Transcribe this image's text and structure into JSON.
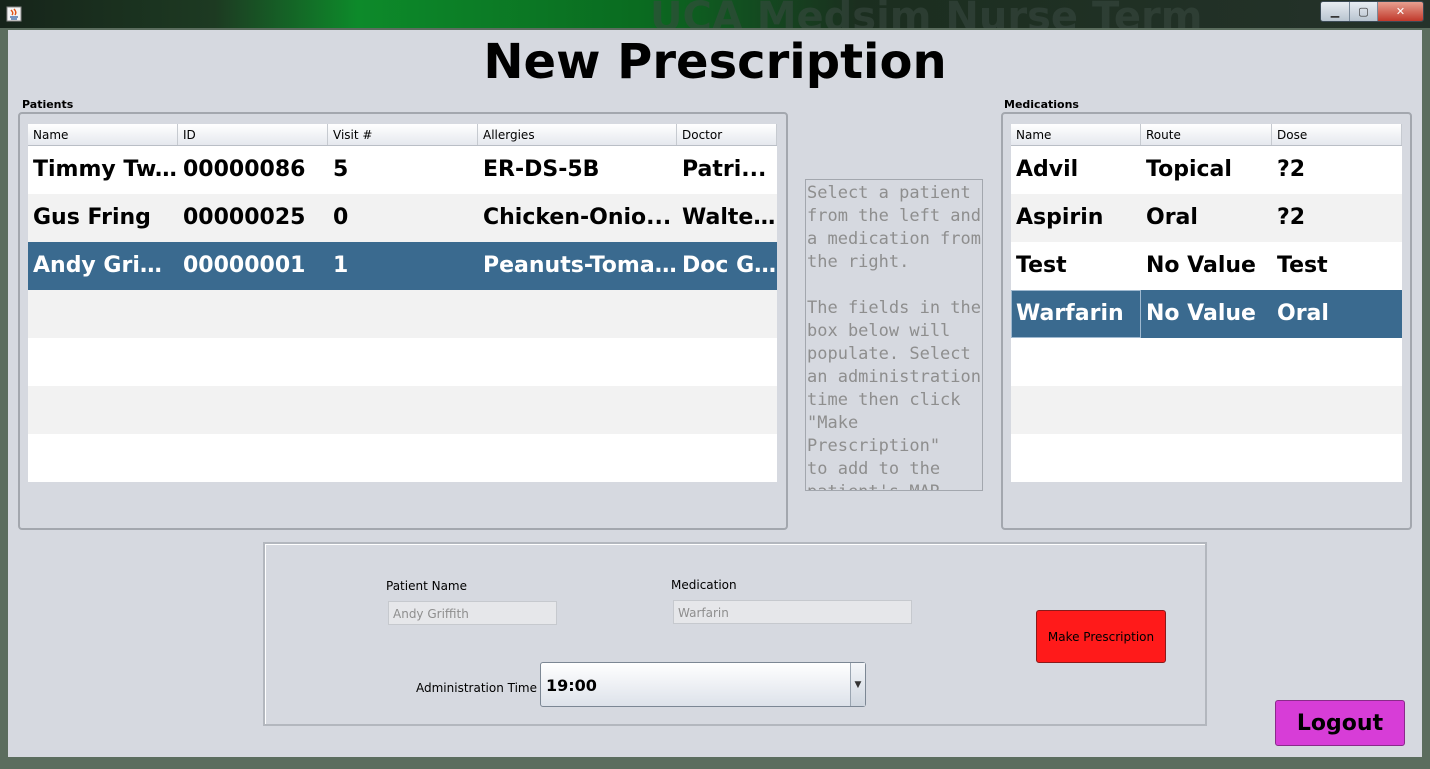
{
  "window": {
    "background_title": "UCA Medsim Nurse Term",
    "controls": {
      "minimize": "▁",
      "maximize": "▢",
      "close": "✕"
    }
  },
  "page_title": "New Prescription",
  "patients": {
    "label": "Patients",
    "columns": [
      "Name",
      "ID",
      "Visit #",
      "Allergies",
      "Doctor"
    ],
    "rows": [
      [
        "Timmy Tw...",
        "00000086",
        "5",
        "ER-DS-5B",
        " Patri..."
      ],
      [
        "Gus Fring",
        "00000025",
        "0",
        "Chicken-Onio...",
        "Walte..."
      ],
      [
        "Andy Griff...",
        "00000001",
        "1",
        "Peanuts-Toma...",
        "Doc G..."
      ]
    ],
    "selected_row": 2,
    "empty_rows": 4
  },
  "medications": {
    "label": "Medications",
    "columns": [
      "Name",
      "Route",
      "Dose"
    ],
    "rows": [
      [
        "Advil",
        "Topical",
        "?2"
      ],
      [
        "Aspirin",
        "Oral",
        "?2"
      ],
      [
        "Test",
        "No Value",
        "Test"
      ],
      [
        "Warfarin",
        "No Value",
        "Oral"
      ]
    ],
    "selected_row": 3,
    "empty_rows": 3
  },
  "instructions": "Select a patient\nfrom the left and\na medication from\nthe right.\n\nThe fields in the\nbox below will\npopulate. Select\nan administration\ntime then click\n\"Make Prescription\"\nto add to the\npatient's MAR.",
  "form": {
    "patient_name_label": "Patient Name",
    "patient_name_value": "Andy Griffith",
    "medication_label": "Medication",
    "medication_value": "Warfarin",
    "admin_time_label": "Administration Time",
    "admin_time_value": "19:00"
  },
  "buttons": {
    "make_prescription": "Make Prescription",
    "logout": "Logout"
  },
  "colors": {
    "make_prescription_bg": "#ff1a1a",
    "logout_bg": "#d73dd7",
    "selection_bg": "#3a6a8f"
  },
  "icons": {
    "combo_arrow": "▼"
  }
}
